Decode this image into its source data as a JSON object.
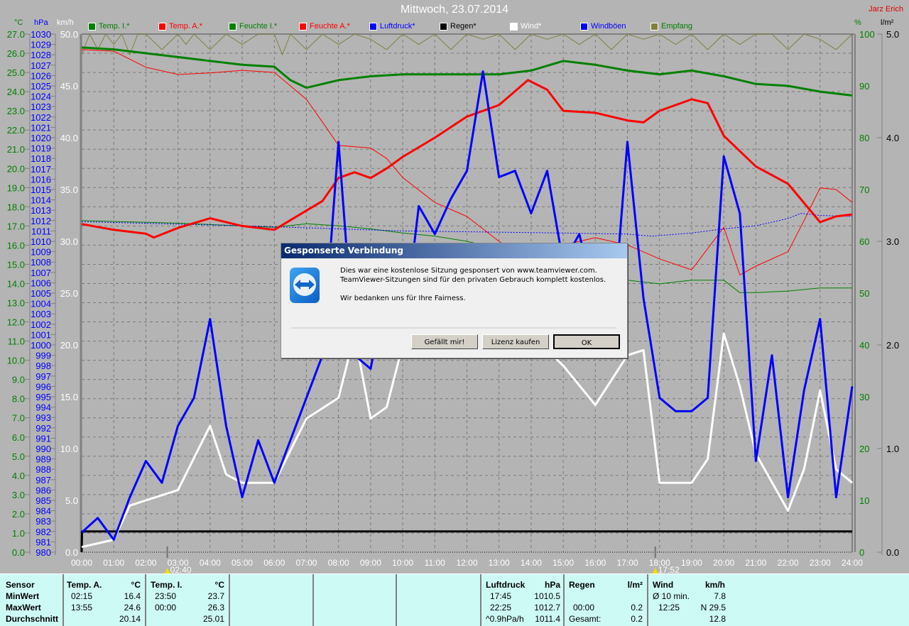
{
  "header": {
    "title": "Mittwoch, 23.07.2014",
    "author": "Jarz Erich"
  },
  "units": {
    "temp": "°C",
    "pressure": "hPa",
    "wind": "km/h",
    "humidity": "%",
    "rain": "l/m²"
  },
  "legend": [
    {
      "label": "Temp. I.*",
      "color": "#008000"
    },
    {
      "label": "Temp. A.*",
      "color": "#ff0000"
    },
    {
      "label": "Feuchte I.*",
      "color": "#008000"
    },
    {
      "label": "Feuchte A.*",
      "color": "#ff0000"
    },
    {
      "label": "Luftdruck*",
      "color": "#0000ff"
    },
    {
      "label": "Regen*",
      "color": "#000000"
    },
    {
      "label": "Wind*",
      "color": "#ffffff"
    },
    {
      "label": "Windböen",
      "color": "#0000ff"
    },
    {
      "label": "Empfang",
      "color": "#808040"
    }
  ],
  "markers": [
    {
      "label": "02:40",
      "hour": 2.667
    },
    {
      "label": "17:52",
      "hour": 17.867
    }
  ],
  "chart_data": {
    "type": "line",
    "title": "Mittwoch, 23.07.2014",
    "x_labels": [
      "00:00",
      "01:00",
      "02:00",
      "03:00",
      "04:00",
      "05:00",
      "06:00",
      "07:00",
      "08:00",
      "09:00",
      "10:00",
      "11:00",
      "12:00",
      "13:00",
      "14:00",
      "15:00",
      "16:00",
      "17:00",
      "18:00",
      "19:00",
      "20:00",
      "21:00",
      "22:00",
      "23:00",
      "24:00"
    ],
    "xlim": [
      0,
      24
    ],
    "axes": {
      "temp": {
        "range": [
          0,
          27
        ],
        "step": 1,
        "decimals": 1
      },
      "pressure": {
        "range": [
          980,
          1030
        ],
        "step": 1,
        "decimals": 0
      },
      "wind": {
        "range": [
          0,
          50
        ],
        "step": 5,
        "decimals": 1
      },
      "humidity": {
        "range": [
          0,
          100
        ],
        "step": 10,
        "decimals": 0
      },
      "rain": {
        "range": [
          0,
          5
        ],
        "step": 1,
        "decimals": 1
      }
    },
    "grid": true,
    "legend_position": "top",
    "series": [
      {
        "name": "Temp. I.*",
        "axis": "temp",
        "color": "#008000",
        "width": 3,
        "x": [
          0,
          1,
          2,
          3,
          4,
          5,
          6,
          6.5,
          7,
          8,
          9,
          10,
          11,
          12,
          13,
          14,
          15,
          16,
          17,
          18,
          19,
          20,
          21,
          22,
          23,
          24
        ],
        "values": [
          26.3,
          26.2,
          26.0,
          25.8,
          25.6,
          25.4,
          25.3,
          24.6,
          24.2,
          24.6,
          24.8,
          24.9,
          24.9,
          24.9,
          24.9,
          25.1,
          25.6,
          25.4,
          25.1,
          24.9,
          25.1,
          24.8,
          24.4,
          24.3,
          24.0,
          23.8
        ]
      },
      {
        "name": "Temp. A.*",
        "axis": "temp",
        "color": "#ff0000",
        "width": 3,
        "x": [
          0,
          1,
          2,
          2.25,
          3,
          4,
          5,
          6,
          7,
          7.5,
          8,
          8.5,
          9,
          9.5,
          10,
          11,
          12,
          13,
          13.9,
          14.5,
          15,
          16,
          17,
          17.5,
          18,
          19,
          19.5,
          20,
          21,
          22,
          22.5,
          23,
          23.5,
          24
        ],
        "values": [
          17.1,
          16.8,
          16.6,
          16.4,
          16.9,
          17.4,
          17.0,
          16.8,
          17.8,
          18.3,
          19.5,
          19.8,
          19.5,
          20.0,
          20.6,
          21.6,
          22.7,
          23.3,
          24.6,
          24.1,
          23.0,
          22.9,
          22.5,
          22.4,
          23.0,
          23.6,
          23.4,
          21.7,
          20.1,
          19.2,
          18.2,
          17.2,
          17.5,
          17.6
        ]
      },
      {
        "name": "Feuchte I.*",
        "axis": "humidity",
        "color": "#008000",
        "width": 1,
        "x": [
          0,
          3,
          6,
          7,
          8,
          9,
          10,
          11,
          12,
          13,
          14,
          15,
          16,
          17,
          18,
          19,
          20,
          20.5,
          21,
          22,
          23,
          24
        ],
        "values": [
          64,
          63.5,
          62.7,
          63.4,
          63,
          62.4,
          61.6,
          61,
          60,
          58.6,
          57.5,
          55.9,
          53.8,
          52.5,
          51.8,
          52.5,
          52.5,
          50.1,
          50.1,
          50.4,
          51,
          51
        ]
      },
      {
        "name": "Feuchte A.*",
        "axis": "humidity",
        "color": "#ff0000",
        "width": 1,
        "x": [
          0,
          1,
          2,
          3,
          4,
          5,
          6,
          7,
          7.5,
          8,
          9,
          9.5,
          10,
          11,
          12,
          13,
          14,
          15,
          16,
          17,
          18,
          19,
          20,
          20.5,
          21,
          22,
          22.5,
          23,
          23.5,
          24
        ],
        "values": [
          97,
          96.7,
          93.6,
          92.2,
          92.5,
          93,
          92.6,
          87.4,
          83,
          78.5,
          78,
          76,
          72.3,
          67.5,
          64.8,
          60,
          55.9,
          59.3,
          60.7,
          59.3,
          56.6,
          54.5,
          62.7,
          53.5,
          55.2,
          58,
          64,
          70.3,
          70,
          67.5
        ]
      },
      {
        "name": "Luftdruck*",
        "axis": "pressure",
        "color": "#0000ff",
        "width": 1,
        "dash": "2,2",
        "x": [
          0,
          5,
          10,
          15,
          17,
          17.75,
          19,
          20,
          21,
          22,
          22.4,
          23,
          24
        ],
        "values": [
          1011.9,
          1011.5,
          1011.0,
          1010.8,
          1010.7,
          1010.5,
          1010.8,
          1011.2,
          1011.5,
          1012.2,
          1012.7,
          1012.5,
          1012.4
        ]
      },
      {
        "name": "Regen*",
        "axis": "rain",
        "color": "#000000",
        "width": 3,
        "x": [
          0,
          0.01,
          24
        ],
        "values": [
          0,
          0.2,
          0.2
        ]
      },
      {
        "name": "Wind*",
        "axis": "wind",
        "color": "#ffffff",
        "width": 3,
        "x": [
          0,
          1,
          1.5,
          2,
          3,
          4,
          4.5,
          5,
          6,
          7,
          8,
          8.5,
          9,
          9.5,
          10,
          11,
          12,
          13,
          14,
          15,
          16,
          17,
          17.5,
          18,
          19,
          19.5,
          20,
          20.5,
          21,
          22,
          22.5,
          23,
          23.5,
          24
        ],
        "values": [
          0.5,
          1.2,
          4.5,
          5,
          6,
          12.2,
          7.5,
          6.7,
          6.7,
          12.9,
          14.9,
          21,
          12.9,
          14,
          20,
          23,
          25,
          27,
          21,
          18,
          14.2,
          19,
          19.5,
          6.7,
          6.7,
          9,
          21.1,
          16,
          9.5,
          4,
          8,
          15.6,
          8,
          6.7
        ]
      },
      {
        "name": "Windböen",
        "axis": "wind",
        "color": "#0000ff",
        "width": 3,
        "x": [
          0,
          0.5,
          1,
          1.5,
          2,
          2.5,
          3,
          3.5,
          4,
          4.5,
          5,
          5.5,
          6,
          6.5,
          7,
          7.5,
          8,
          8.5,
          9,
          9.5,
          10,
          10.5,
          11,
          11.5,
          12,
          12.5,
          13,
          13.5,
          14,
          14.5,
          15,
          15.5,
          16,
          16.5,
          17,
          17.5,
          18,
          18.5,
          19,
          19.5,
          20,
          20.5,
          21,
          21.5,
          22,
          22.5,
          23,
          23.5,
          24
        ],
        "values": [
          1.9,
          3.3,
          1.2,
          5.3,
          8.8,
          6.7,
          12.2,
          14.9,
          22.5,
          12.2,
          5.3,
          10.8,
          6.7,
          10.8,
          14.9,
          19.0,
          39.6,
          19.0,
          17.7,
          25.9,
          20.4,
          33.4,
          30.7,
          34.1,
          36.8,
          46.4,
          36.2,
          36.8,
          32.7,
          36.8,
          27.9,
          30.7,
          24.5,
          20.4,
          39.6,
          24.5,
          14.9,
          13.6,
          13.6,
          14.9,
          38.2,
          32.7,
          8.8,
          19.0,
          5.3,
          15.6,
          22.5,
          5.3,
          16.0
        ]
      },
      {
        "name": "Empfang",
        "axis": "humidity",
        "color": "#808040",
        "width": 1,
        "x": [
          0,
          0.25,
          0.5,
          0.75,
          1,
          1.25,
          1.5,
          1.75,
          2,
          2.5,
          3,
          3.25,
          3.5,
          4,
          4.5,
          5,
          5.5,
          6,
          6.25,
          6.5,
          7,
          7.5,
          8,
          8.5,
          9,
          9.5,
          10,
          10.5,
          11,
          11.5,
          12,
          12.5,
          13,
          13.5,
          14,
          14.5,
          15,
          15.5,
          16,
          16.5,
          17,
          17.5,
          18,
          18.5,
          19,
          19.5,
          20,
          20.5,
          21,
          21.5,
          22,
          22.5,
          23,
          23.5,
          24
        ],
        "values": [
          96,
          100,
          97,
          100,
          98,
          100,
          96,
          100,
          100,
          97,
          100,
          98,
          100,
          97,
          100,
          98,
          100,
          100,
          96,
          100,
          97,
          100,
          98,
          100,
          99,
          97,
          100,
          98,
          100,
          97,
          100,
          99,
          100,
          97,
          100,
          99,
          100,
          98,
          100,
          97,
          100,
          99,
          100,
          98,
          100,
          97,
          100,
          98,
          100,
          100,
          97,
          100,
          99,
          97,
          100
        ]
      }
    ]
  },
  "stats": {
    "row_labels": [
      "Sensor",
      "MinWert",
      "MaxWert",
      "Durchschnitt"
    ],
    "temp_a": {
      "header": "Temp. A.",
      "unit": "°C",
      "min_time": "02:15",
      "min": "16.4",
      "max_time": "13:55",
      "max": "24.6",
      "avg": "20.14"
    },
    "temp_i": {
      "header": "Temp. I.",
      "unit": "°C",
      "min_time": "23:50",
      "min": "23.7",
      "max_time": "00:00",
      "max": "26.3",
      "avg": "25.01"
    },
    "pressure": {
      "header": "Luftdruck",
      "unit": "hPa",
      "min_time": "17:45",
      "min": "1010.5",
      "max_time": "22:25",
      "max": "1012.7",
      "trend": "^0.9hPa/h",
      "avg": "1011.4"
    },
    "rain": {
      "header": "Regen",
      "unit": "l/m²",
      "max_time": "00:00",
      "max": "0.2",
      "total_label": "Gesamt:",
      "total": "0.2"
    },
    "wind": {
      "header": "Wind",
      "unit": "km/h",
      "avg10_label": "Ø 10 min.",
      "avg10": "7.8",
      "max_time": "12:25",
      "max": "N 29.5",
      "avg": "12.8"
    }
  },
  "dialog": {
    "title": "Gesponserte Verbindung",
    "line1": "Dies war eine kostenlose Sitzung gesponsert von www.teamviewer.com.",
    "line2": "TeamViewer-Sitzungen sind für den privaten Gebrauch komplett kostenlos.",
    "line3": "Wir bedanken uns für Ihre Fairness.",
    "buttons": [
      "Gefällt mir!",
      "Lizenz kaufen",
      "OK"
    ]
  }
}
